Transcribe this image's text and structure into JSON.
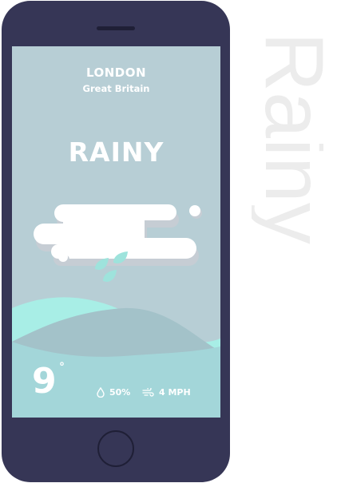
{
  "background_word": "Rainy",
  "location": {
    "city": "LONDON",
    "country": "Great Britain"
  },
  "condition": "RAINY",
  "weather_icon": "rain-cloud-icon",
  "temperature": {
    "value": "9",
    "unit_symbol": "°"
  },
  "stats": {
    "humidity": {
      "icon": "droplet-icon",
      "value": "50%"
    },
    "wind": {
      "icon": "wind-icon",
      "value": "4 MPH"
    }
  },
  "colors": {
    "phone_body": "#363656",
    "screen": "#b7ced5",
    "wave_accent": "#a8eee6",
    "raindrop": "#9ee3dc",
    "text": "#ffffff"
  }
}
